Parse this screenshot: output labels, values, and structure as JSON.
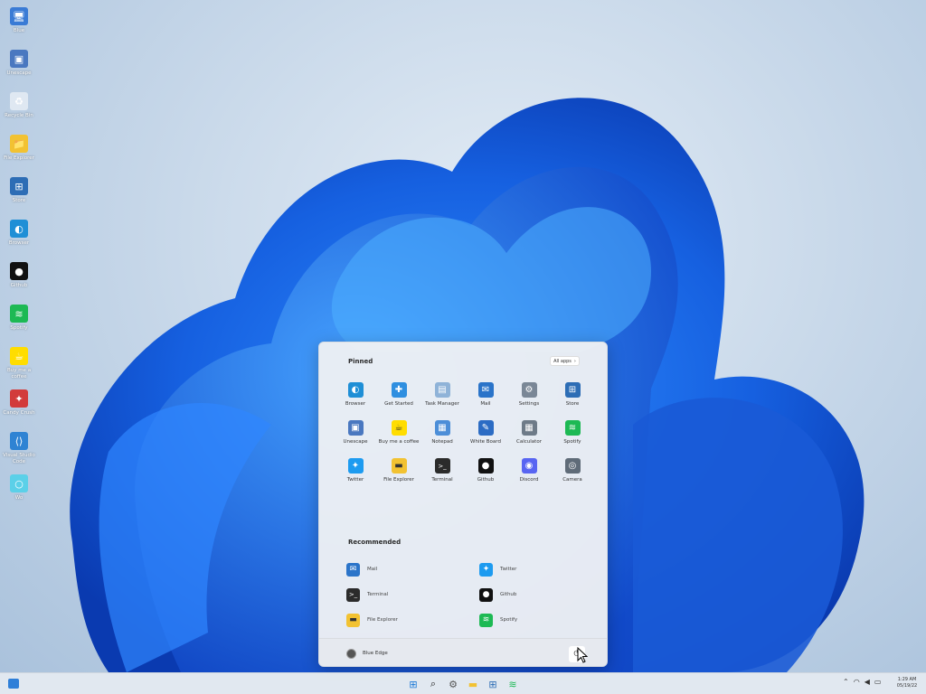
{
  "desktop": {
    "icons": [
      {
        "label": "Blue",
        "icon": "blue-icon",
        "color": "#3a7bd5",
        "glyph": "🖥"
      },
      {
        "label": "Unescape",
        "icon": "unescape-icon",
        "color": "#4a78c0",
        "glyph": "▣"
      },
      {
        "label": "Recycle Bin",
        "icon": "recycle-bin-icon",
        "color": "#dfe8f2",
        "glyph": "♻"
      },
      {
        "label": "File Explorer",
        "icon": "folder-icon",
        "color": "#f2c232",
        "glyph": "📁"
      },
      {
        "label": "Store",
        "icon": "store-icon",
        "color": "#2d6db5",
        "glyph": "⊞"
      },
      {
        "label": "Browser",
        "icon": "edge-icon",
        "color": "#1f8fd6",
        "glyph": "◐"
      },
      {
        "label": "Github",
        "icon": "github-icon",
        "color": "#111111",
        "glyph": "●"
      },
      {
        "label": "Spotify",
        "icon": "spotify-icon",
        "color": "#1db954",
        "glyph": "≋"
      },
      {
        "label": "Buy me a coffee",
        "icon": "coffee-icon",
        "color": "#ffdd00",
        "glyph": "☕"
      },
      {
        "label": "Candy Crush",
        "icon": "candy-crush-icon",
        "color": "#d23b3b",
        "glyph": "✦"
      },
      {
        "label": "Visual Studio Code",
        "icon": "vscode-icon",
        "color": "#2f83d3",
        "glyph": "⟨⟩"
      },
      {
        "label": "Wo",
        "icon": "wo-icon",
        "color": "#5bd0e8",
        "glyph": "○"
      }
    ]
  },
  "start_menu": {
    "pinned_title": "Pinned",
    "all_apps_label": "All apps",
    "pinned": [
      {
        "label": "Browser",
        "icon": "edge-icon",
        "color": "#1f8fd6",
        "glyph": "◐"
      },
      {
        "label": "Get Started",
        "icon": "get-started-icon",
        "color": "#2f8fe0",
        "glyph": "✚"
      },
      {
        "label": "Task Manager",
        "icon": "task-manager-icon",
        "color": "#8fb3d8",
        "glyph": "▤"
      },
      {
        "label": "Mail",
        "icon": "mail-icon",
        "color": "#2b74c9",
        "glyph": "✉"
      },
      {
        "label": "Settings",
        "icon": "gear-icon",
        "color": "#7a8796",
        "glyph": "⚙"
      },
      {
        "label": "Store",
        "icon": "store-icon",
        "color": "#2d6db5",
        "glyph": "⊞"
      },
      {
        "label": "Unescape",
        "icon": "unescape-icon",
        "color": "#4a78c0",
        "glyph": "▣"
      },
      {
        "label": "Buy me a coffee",
        "icon": "coffee-icon",
        "color": "#ffdd00",
        "glyph": "☕"
      },
      {
        "label": "Notepad",
        "icon": "notepad-icon",
        "color": "#4c8ed8",
        "glyph": "▦"
      },
      {
        "label": "White Board",
        "icon": "whiteboard-icon",
        "color": "#2c6cc4",
        "glyph": "✎"
      },
      {
        "label": "Calculator",
        "icon": "calculator-icon",
        "color": "#6e7b88",
        "glyph": "▦"
      },
      {
        "label": "Spotify",
        "icon": "spotify-icon",
        "color": "#1db954",
        "glyph": "≋"
      },
      {
        "label": "Twitter",
        "icon": "twitter-icon",
        "color": "#1d9bf0",
        "glyph": "✦"
      },
      {
        "label": "File Explorer",
        "icon": "folder-icon",
        "color": "#f2c232",
        "glyph": "▬"
      },
      {
        "label": "Terminal",
        "icon": "terminal-icon",
        "color": "#2b2b2b",
        "glyph": ">_"
      },
      {
        "label": "Github",
        "icon": "github-icon",
        "color": "#111111",
        "glyph": "●"
      },
      {
        "label": "Discord",
        "icon": "discord-icon",
        "color": "#5865f2",
        "glyph": "◉"
      },
      {
        "label": "Camera",
        "icon": "camera-icon",
        "color": "#5f6b78",
        "glyph": "◎"
      }
    ],
    "recommended_title": "Recommended",
    "recommended": [
      {
        "label": "Mail",
        "icon": "mail-icon",
        "color": "#2b74c9",
        "glyph": "✉"
      },
      {
        "label": "Twitter",
        "icon": "twitter-icon",
        "color": "#1d9bf0",
        "glyph": "✦"
      },
      {
        "label": "Terminal",
        "icon": "terminal-icon",
        "color": "#2b2b2b",
        "glyph": ">_"
      },
      {
        "label": "Github",
        "icon": "github-icon",
        "color": "#111111",
        "glyph": "●"
      },
      {
        "label": "File Explorer",
        "icon": "folder-icon",
        "color": "#f2c232",
        "glyph": "▬"
      },
      {
        "label": "Spotify",
        "icon": "spotify-icon",
        "color": "#1db954",
        "glyph": "≋"
      }
    ],
    "user_name": "Blue Edge",
    "power_icon": "power-icon"
  },
  "taskbar": {
    "center": [
      {
        "name": "start-button",
        "icon": "windows-icon",
        "glyph": "⊞",
        "color": "#1a78d6"
      },
      {
        "name": "search-button",
        "icon": "search-icon",
        "glyph": "⌕",
        "color": "#222222"
      },
      {
        "name": "settings-button",
        "icon": "gear-icon",
        "glyph": "⚙",
        "color": "#555555"
      },
      {
        "name": "file-explorer-button",
        "icon": "folder-icon",
        "glyph": "▬",
        "color": "#f2c232"
      },
      {
        "name": "store-button",
        "icon": "store-icon",
        "glyph": "⊞",
        "color": "#2d6db5"
      },
      {
        "name": "spotify-button",
        "icon": "spotify-icon",
        "glyph": "≋",
        "color": "#1db954"
      }
    ],
    "tray": [
      {
        "name": "chevron-up-icon",
        "glyph": "⌃"
      },
      {
        "name": "wifi-icon",
        "glyph": "◠"
      },
      {
        "name": "volume-icon",
        "glyph": "◀"
      },
      {
        "name": "battery-icon",
        "glyph": "▭"
      }
    ],
    "time": "1:29 AM",
    "date": "05/19/22"
  }
}
